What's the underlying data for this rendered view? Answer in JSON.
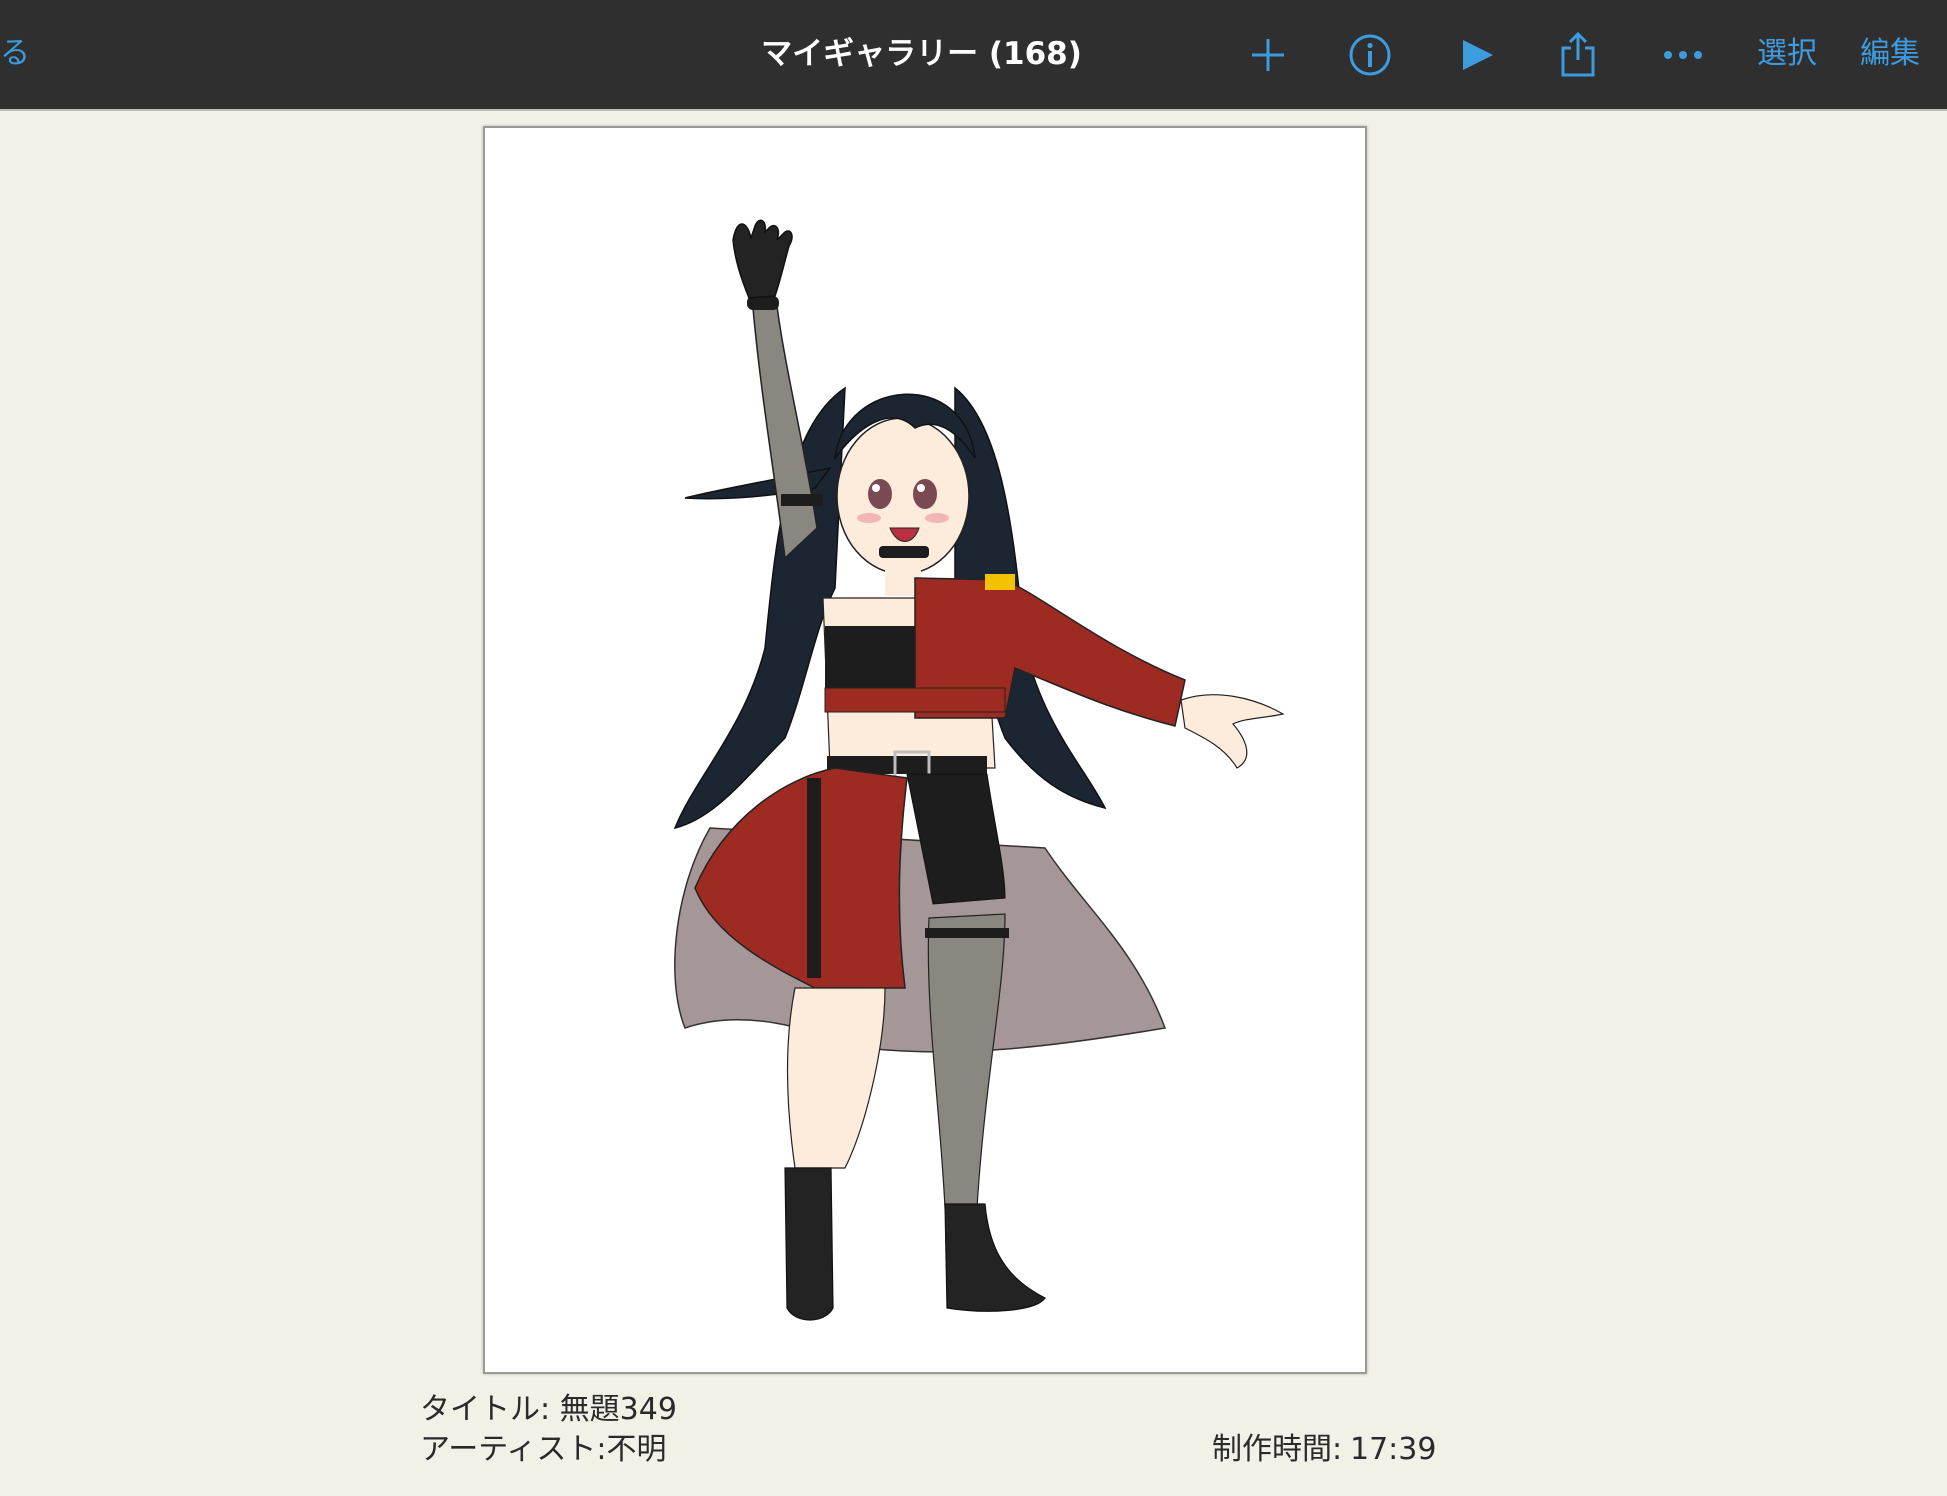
{
  "header": {
    "back_label": "る",
    "title": "マイギャラリー (168)",
    "select_label": "選択",
    "edit_label": "編集",
    "icons": [
      "plus-icon",
      "info-icon",
      "play-icon",
      "share-icon",
      "more-icon"
    ]
  },
  "artwork": {
    "title_line": "タイトル: 無題349",
    "artist_line": "アーティスト:不明",
    "time_label": "制作時間:",
    "time_value": "17:39"
  },
  "colors": {
    "topbar": "#2f2f2f",
    "accent": "#3d9be0",
    "background": "#f2f1e8",
    "hair": "#1c2633",
    "jacket_red": "#9d2b22",
    "cape": "#a59797",
    "skin": "#fdebdc",
    "stocking": "#8a8680"
  }
}
